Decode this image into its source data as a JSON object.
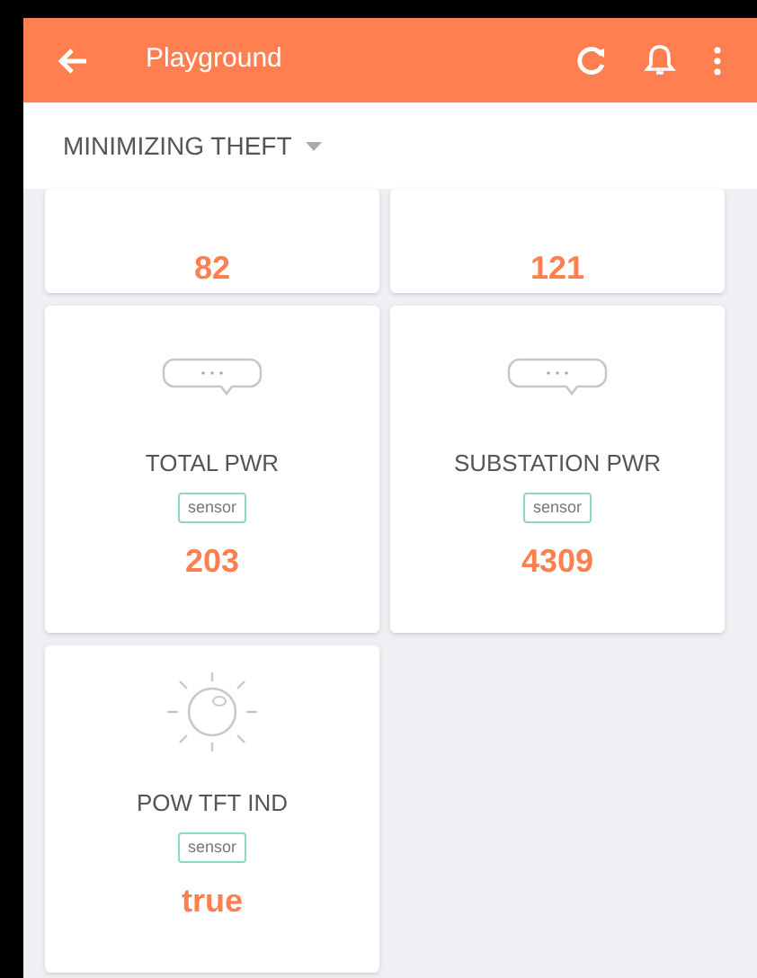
{
  "app_bar": {
    "title": "Playground"
  },
  "selector": {
    "label": "MINIMIZING THEFT"
  },
  "cards": [
    {
      "kind": "value-only",
      "value": "82"
    },
    {
      "kind": "value-only",
      "value": "121"
    },
    {
      "kind": "bubble",
      "name": "TOTAL PWR",
      "tag": "sensor",
      "value": "203"
    },
    {
      "kind": "bubble",
      "name": "SUBSTATION PWR",
      "tag": "sensor",
      "value": "4309"
    },
    {
      "kind": "bulb",
      "name": "POW TFT IND",
      "tag": "sensor",
      "value": "true"
    }
  ]
}
